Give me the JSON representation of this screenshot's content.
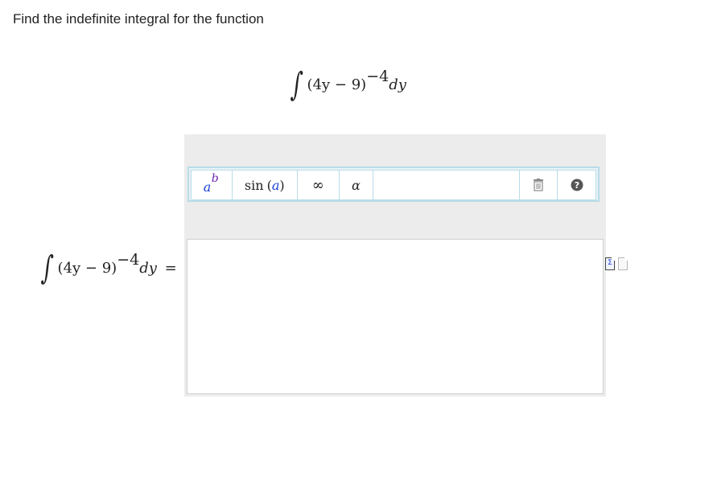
{
  "prompt": "Find the indefinite integral for the function",
  "expression": {
    "integral_symbol": "∫",
    "body": "(4y − 9)",
    "exponent": "−4",
    "differential": "dy",
    "equals": "="
  },
  "toolbar": {
    "power": {
      "base": "a",
      "exponent": "b"
    },
    "function": {
      "name": "sin",
      "open": "(",
      "arg": "a",
      "close": ")"
    },
    "infinity": "∞",
    "greek": "α"
  },
  "answer": {
    "value": ""
  },
  "icons": {
    "trash": "trash-icon",
    "help": "help-icon",
    "formula_doc": "formula-document-icon",
    "blank_doc": "document-icon"
  },
  "colors": {
    "toolbar_border": "#b9dce8",
    "panel_bg": "#ececec",
    "variable_blue": "#1a3fd6",
    "exponent_purple": "#6a1fb0"
  }
}
